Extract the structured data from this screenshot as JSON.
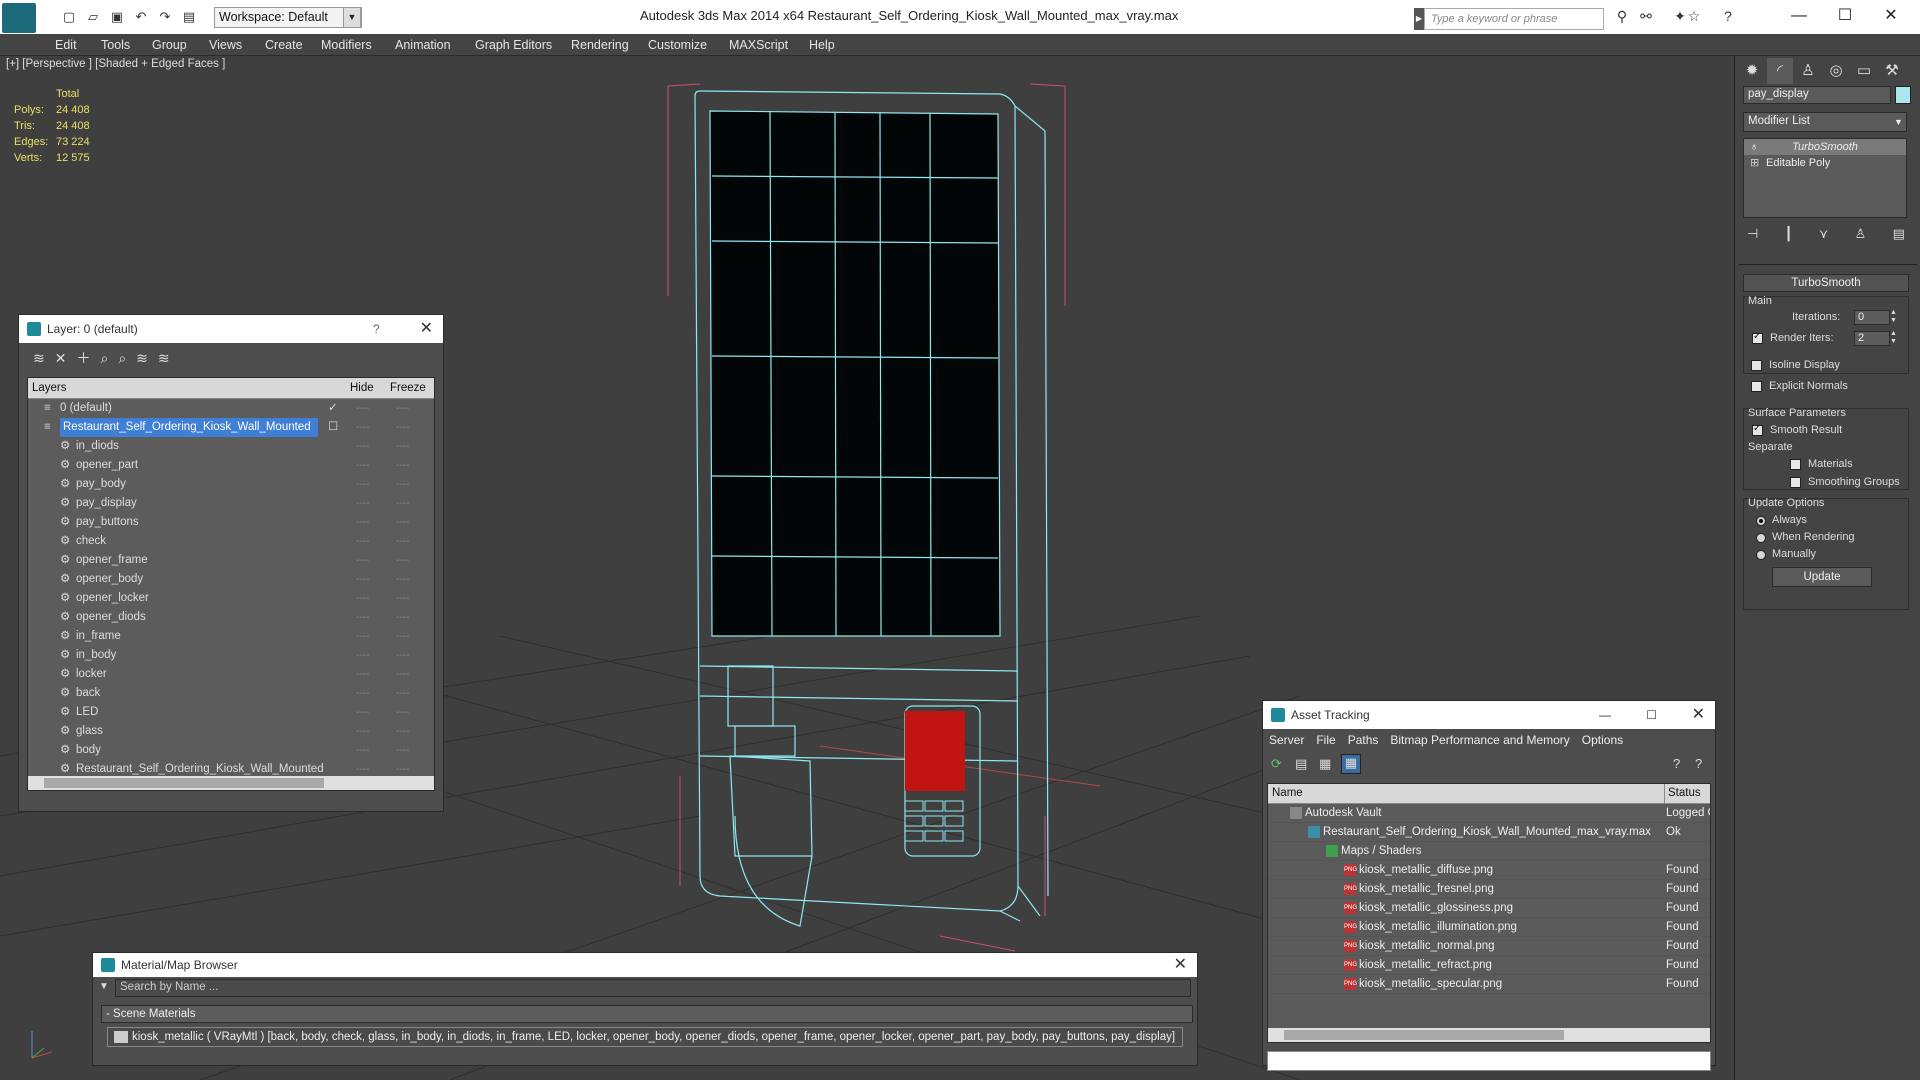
{
  "app": {
    "title": "Autodesk 3ds Max  2014 x64      Restaurant_Self_Ordering_Kiosk_Wall_Mounted_max_vray.max",
    "workspace": "Workspace: Default",
    "search_placeholder": "Type a keyword or phrase"
  },
  "menu": [
    "Edit",
    "Tools",
    "Group",
    "Views",
    "Create",
    "Modifiers",
    "Animation",
    "Graph Editors",
    "Rendering",
    "Customize",
    "MAXScript",
    "Help"
  ],
  "viewport": {
    "label": "[+] [Perspective ] [Shaded + Edged Faces ]",
    "stats": {
      "header": "Total",
      "rows": [
        {
          "label": "Polys:",
          "value": "24 408"
        },
        {
          "label": "Tris:",
          "value": "24 408"
        },
        {
          "label": "Edges:",
          "value": "73 224"
        },
        {
          "label": "Verts:",
          "value": "12 575"
        }
      ]
    }
  },
  "layer_panel": {
    "title": "Layer: 0 (default)",
    "help": "?",
    "col_layers": "Layers",
    "col_hide": "Hide",
    "col_freeze": "Freeze",
    "rows": [
      {
        "name": "0 (default)",
        "level": 1
      },
      {
        "name": "Restaurant_Self_Ordering_Kiosk_Wall_Mounted",
        "level": 1,
        "selected": true
      },
      {
        "name": "in_diods",
        "level": 2
      },
      {
        "name": "opener_part",
        "level": 2
      },
      {
        "name": "pay_body",
        "level": 2
      },
      {
        "name": "pay_display",
        "level": 2
      },
      {
        "name": "pay_buttons",
        "level": 2
      },
      {
        "name": "check",
        "level": 2
      },
      {
        "name": "opener_frame",
        "level": 2
      },
      {
        "name": "opener_body",
        "level": 2
      },
      {
        "name": "opener_locker",
        "level": 2
      },
      {
        "name": "opener_diods",
        "level": 2
      },
      {
        "name": "in_frame",
        "level": 2
      },
      {
        "name": "in_body",
        "level": 2
      },
      {
        "name": "locker",
        "level": 2
      },
      {
        "name": "back",
        "level": 2
      },
      {
        "name": "LED",
        "level": 2
      },
      {
        "name": "glass",
        "level": 2
      },
      {
        "name": "body",
        "level": 2
      },
      {
        "name": "Restaurant_Self_Ordering_Kiosk_Wall_Mounted",
        "level": 2
      }
    ]
  },
  "command_panel": {
    "object_name": "pay_display",
    "modifier_list": "Modifier List",
    "stack": [
      "TurboSmooth",
      "Editable Poly"
    ],
    "rollout": "TurboSmooth",
    "main": "Main",
    "iterations_label": "Iterations:",
    "iterations": "0",
    "render_iters_label": "Render Iters:",
    "render_iters": "2",
    "isoline": "Isoline Display",
    "explicit": "Explicit Normals",
    "surface": "Surface Parameters",
    "smooth_result": "Smooth Result",
    "separate": "Separate",
    "materials": "Materials",
    "smoothing_groups": "Smoothing Groups",
    "update_options": "Update Options",
    "always": "Always",
    "when_rendering": "When Rendering",
    "manually": "Manually",
    "update": "Update"
  },
  "asset_tracking": {
    "title": "Asset Tracking",
    "menu": [
      "Server",
      "File",
      "Paths",
      "Bitmap Performance and Memory",
      "Options"
    ],
    "col_name": "Name",
    "col_status": "Status",
    "rows": [
      {
        "name": "Autodesk Vault",
        "status": "Logged O",
        "indent": 1
      },
      {
        "name": "Restaurant_Self_Ordering_Kiosk_Wall_Mounted_max_vray.max",
        "status": "Ok",
        "indent": 2
      },
      {
        "name": "Maps / Shaders",
        "status": "",
        "indent": 3
      },
      {
        "name": "kiosk_metallic_diffuse.png",
        "status": "Found",
        "indent": 4
      },
      {
        "name": "kiosk_metallic_fresnel.png",
        "status": "Found",
        "indent": 4
      },
      {
        "name": "kiosk_metallic_glossiness.png",
        "status": "Found",
        "indent": 4
      },
      {
        "name": "kiosk_metallic_illumination.png",
        "status": "Found",
        "indent": 4
      },
      {
        "name": "kiosk_metallic_normal.png",
        "status": "Found",
        "indent": 4
      },
      {
        "name": "kiosk_metallic_refract.png",
        "status": "Found",
        "indent": 4
      },
      {
        "name": "kiosk_metallic_specular.png",
        "status": "Found",
        "indent": 4
      }
    ]
  },
  "material_browser": {
    "title": "Material/Map Browser",
    "search_placeholder": "Search by Name ...",
    "section": "- Scene Materials",
    "material": "kiosk_metallic ( VRayMtl ) [back, body, check, glass, in_body, in_diods, in_frame, LED, locker, opener_body, opener_diods, opener_frame, opener_locker, opener_part, pay_body, pay_buttons, pay_display]"
  }
}
